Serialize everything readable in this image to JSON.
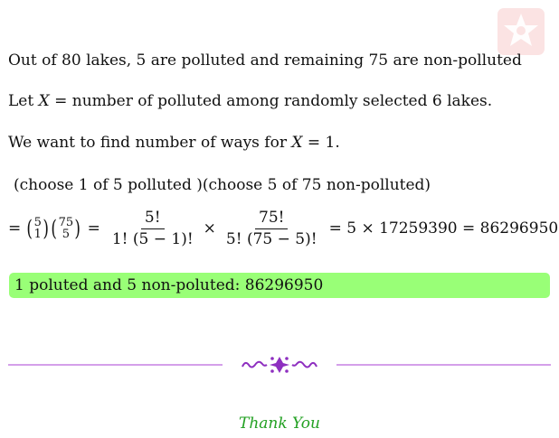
{
  "intro": {
    "line1": "Out of 80 lakes, 5 are polluted and remaining 75 are non-polluted",
    "line2_pre": "Let ",
    "line2_var": "X",
    "line2_post": " = number of polluted among randomly selected 6 lakes.",
    "line3_pre": "We want to find number of ways for ",
    "line3_var": "X",
    "line3_post": " = 1."
  },
  "explanation": "(choose 1 of 5 polluted )(choose 5 of 75 non-polluted)",
  "equation": {
    "lead": "=",
    "binom1_top": "5",
    "binom1_bottom": "1",
    "binom2_top": "75",
    "binom2_bottom": "5",
    "eq": "=",
    "frac1_num": "5!",
    "frac1_den": "1! (5 − 1)!",
    "times": "×",
    "frac2_num": "75!",
    "frac2_den": "5! (75 − 5)!",
    "result": "= 5 × 17259390 = 86296950"
  },
  "answer": "1 poluted and 5 non-poluted:  86296950",
  "footer": {
    "thanks": "Thank You"
  },
  "colors": {
    "answer_bg": "#99ff77",
    "divider": "#bb66dd",
    "thanks": "#22a022",
    "logo": "#f6cccc"
  }
}
